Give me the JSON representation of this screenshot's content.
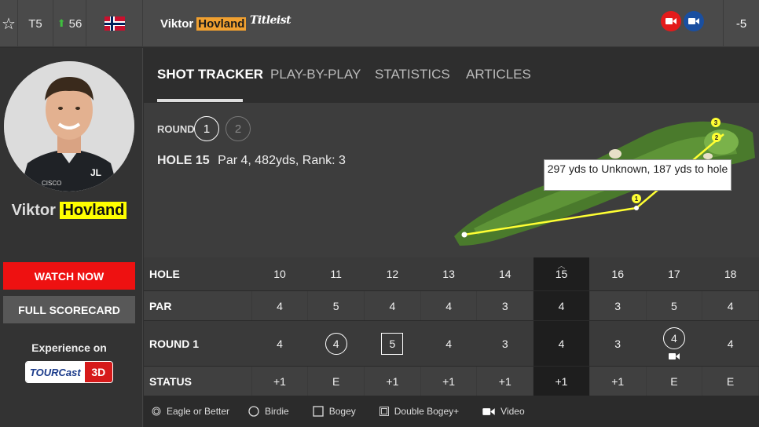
{
  "topbar": {
    "position": "T5",
    "rank_move": "56",
    "player_first": "Viktor",
    "player_last": "Hovland",
    "sponsor": "Titleist",
    "total_score": "-5"
  },
  "sidebar": {
    "first_name": "Viktor",
    "last_name": "Hovland",
    "watch_label": "WATCH NOW",
    "scorecard_label": "FULL SCORECARD",
    "experience_label": "Experience on",
    "tourcast_label": "TOURCast",
    "tourcast_3d": "3D"
  },
  "tabs": [
    {
      "label": "SHOT TRACKER",
      "active": true
    },
    {
      "label": "PLAY-BY-PLAY",
      "active": false
    },
    {
      "label": "STATISTICS",
      "active": false
    },
    {
      "label": "ARTICLES",
      "active": false
    }
  ],
  "tracker": {
    "round_label": "ROUND",
    "rounds": [
      "1",
      "2"
    ],
    "selected_round": "1",
    "hole_label": "HOLE 15",
    "hole_detail": "Par 4, 482yds, Rank: 3",
    "tooltip": "297 yds to Unknown, 187 yds to hole",
    "shot_markers": [
      "1",
      "2",
      "3"
    ]
  },
  "scorecard": {
    "headers": {
      "hole": "HOLE",
      "par": "PAR",
      "round": "ROUND 1",
      "status": "STATUS"
    },
    "holes": [
      "10",
      "11",
      "12",
      "13",
      "14",
      "15",
      "16",
      "17",
      "18"
    ],
    "par": [
      "4",
      "5",
      "4",
      "4",
      "3",
      "4",
      "3",
      "5",
      "4"
    ],
    "round1": [
      "4",
      "4",
      "5",
      "4",
      "3",
      "4",
      "3",
      "4",
      "4"
    ],
    "round1_marks": [
      "none",
      "circle",
      "square",
      "none",
      "none",
      "none",
      "none",
      "circle",
      "none"
    ],
    "status": [
      "+1",
      "E",
      "+1",
      "+1",
      "+1",
      "+1",
      "+1",
      "E",
      "E"
    ],
    "current_hole": "15"
  },
  "legend": [
    {
      "label": "Eagle or Better",
      "icon": "double-circle-icon"
    },
    {
      "label": "Birdie",
      "icon": "circle-icon"
    },
    {
      "label": "Bogey",
      "icon": "square-icon"
    },
    {
      "label": "Double Bogey+",
      "icon": "double-square-icon"
    },
    {
      "label": "Video",
      "icon": "video-icon"
    }
  ],
  "colors": {
    "accent_red": "#ee1111",
    "highlight_orange": "#f0a030",
    "highlight_yellow": "#ffff00",
    "shot_line": "#ffff33"
  }
}
